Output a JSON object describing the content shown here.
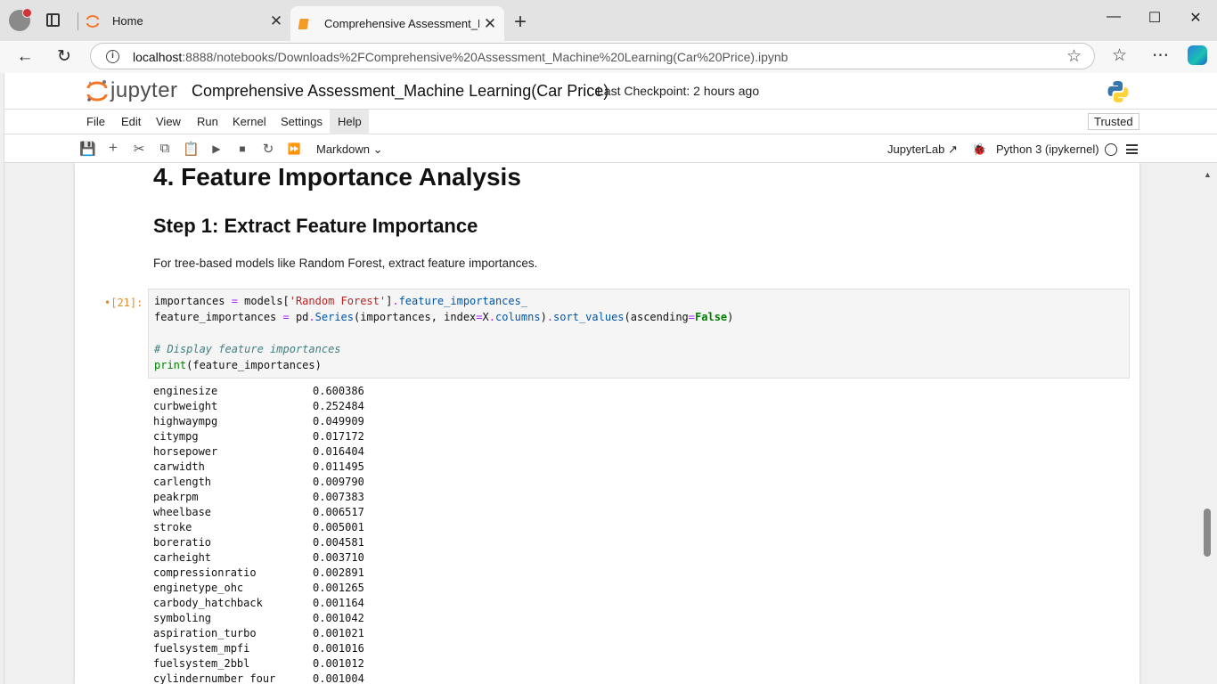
{
  "browser": {
    "tabs": [
      {
        "title": "Home"
      },
      {
        "title": "Comprehensive Assessment_Mac"
      }
    ],
    "url_host": "localhost",
    "url_rest": ":8888/notebooks/Downloads%2FComprehensive%20Assessment_Machine%20Learning(Car%20Price).ipynb",
    "icons": {
      "new_tab": "+",
      "minimize": "—",
      "maximize": "☐",
      "close": "✕",
      "back": "←",
      "reload": "↻",
      "favorites": "☆",
      "more": "⋯"
    }
  },
  "jupyter": {
    "logo_text": "jupyter",
    "notebook_title": "Comprehensive Assessment_Machine Learning(Car Price)",
    "checkpoint": "Last Checkpoint: 2 hours ago",
    "menu": [
      "File",
      "Edit",
      "View",
      "Run",
      "Kernel",
      "Settings",
      "Help"
    ],
    "trusted": "Trusted",
    "cell_type": "Markdown",
    "jupyterlab_link": "JupyterLab",
    "kernel_name": "Python 3 (ipykernel)"
  },
  "notebook": {
    "heading1": "4. Feature Importance Analysis",
    "heading2": "Step 1: Extract Feature Importance",
    "paragraph": "For tree-based models like Random Forest, extract feature importances.",
    "prompt": "[21]:",
    "output_rows": [
      {
        "name": "enginesize",
        "value": "0.600386"
      },
      {
        "name": "curbweight",
        "value": "0.252484"
      },
      {
        "name": "highwaympg",
        "value": "0.049909"
      },
      {
        "name": "citympg",
        "value": "0.017172"
      },
      {
        "name": "horsepower",
        "value": "0.016404"
      },
      {
        "name": "carwidth",
        "value": "0.011495"
      },
      {
        "name": "carlength",
        "value": "0.009790"
      },
      {
        "name": "peakrpm",
        "value": "0.007383"
      },
      {
        "name": "wheelbase",
        "value": "0.006517"
      },
      {
        "name": "stroke",
        "value": "0.005001"
      },
      {
        "name": "boreratio",
        "value": "0.004581"
      },
      {
        "name": "carheight",
        "value": "0.003710"
      },
      {
        "name": "compressionratio",
        "value": "0.002891"
      },
      {
        "name": "enginetype_ohc",
        "value": "0.001265"
      },
      {
        "name": "carbody_hatchback",
        "value": "0.001164"
      },
      {
        "name": "symboling",
        "value": "0.001042"
      },
      {
        "name": "aspiration_turbo",
        "value": "0.001021"
      },
      {
        "name": "fuelsystem_mpfi",
        "value": "0.001016"
      },
      {
        "name": "fuelsystem_2bbl",
        "value": "0.001012"
      },
      {
        "name": "cylindernumber_four",
        "value": "0.001004"
      }
    ]
  }
}
